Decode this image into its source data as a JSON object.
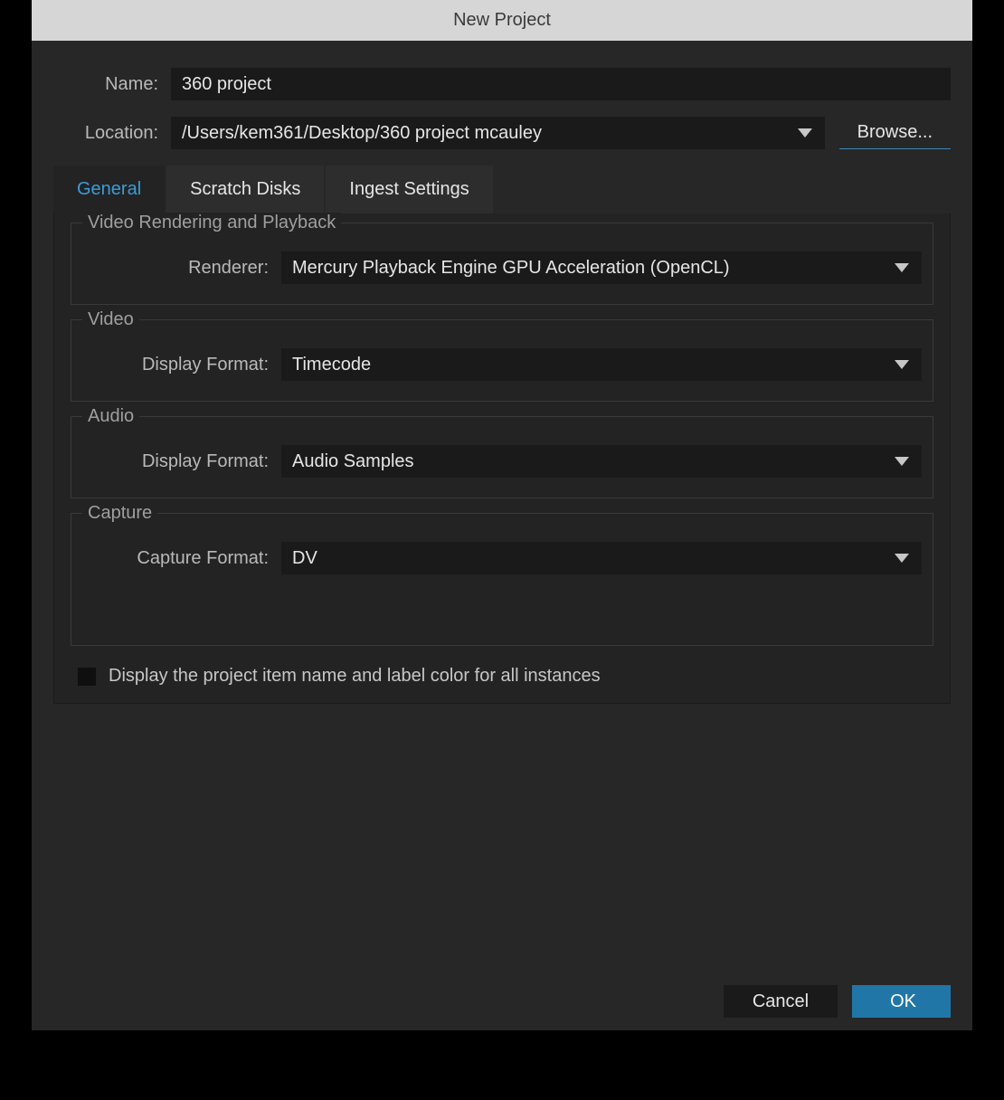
{
  "title": "New Project",
  "name": {
    "label": "Name:",
    "value": "360 project"
  },
  "location": {
    "label": "Location:",
    "value": "/Users/kem361/Desktop/360 project mcauley",
    "browse": "Browse..."
  },
  "tabs": [
    {
      "label": "General",
      "active": true
    },
    {
      "label": "Scratch Disks",
      "active": false
    },
    {
      "label": "Ingest Settings",
      "active": false
    }
  ],
  "sections": {
    "videoRenderingPlayback": {
      "legend": "Video Rendering and Playback",
      "renderer": {
        "label": "Renderer:",
        "value": "Mercury Playback Engine GPU Acceleration (OpenCL)"
      }
    },
    "video": {
      "legend": "Video",
      "displayFormat": {
        "label": "Display Format:",
        "value": "Timecode"
      }
    },
    "audio": {
      "legend": "Audio",
      "displayFormat": {
        "label": "Display Format:",
        "value": "Audio Samples"
      }
    },
    "capture": {
      "legend": "Capture",
      "captureFormat": {
        "label": "Capture Format:",
        "value": "DV"
      }
    }
  },
  "displayAllInstances": {
    "label": "Display the project item name and label color for all instances",
    "checked": false
  },
  "footer": {
    "cancel": "Cancel",
    "ok": "OK"
  }
}
